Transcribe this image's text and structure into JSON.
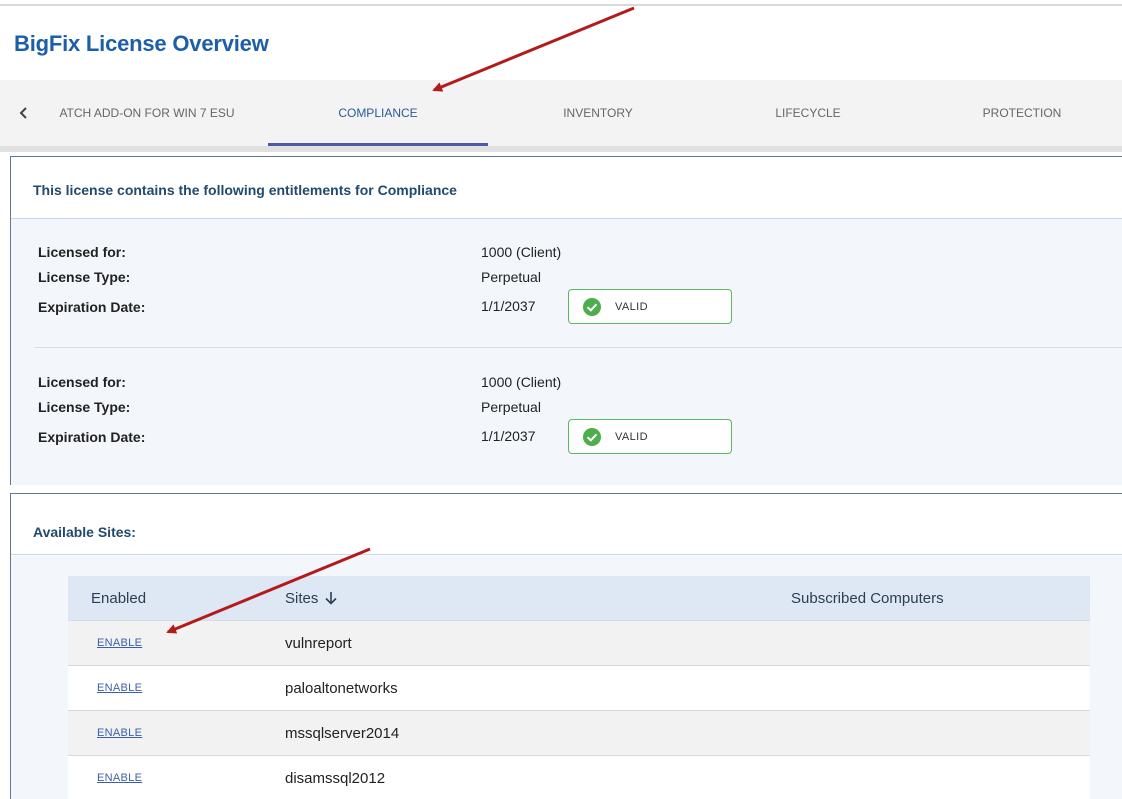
{
  "page": {
    "title": "BigFix License Overview"
  },
  "tabs": {
    "items": [
      {
        "label": "ATCH ADD-ON FOR WIN 7 ESU"
      },
      {
        "label": "COMPLIANCE",
        "active": true
      },
      {
        "label": "INVENTORY"
      },
      {
        "label": "LIFECYCLE"
      },
      {
        "label": "PROTECTION"
      }
    ]
  },
  "entitlements": {
    "heading": "This license contains the following entitlements for Compliance",
    "labels": {
      "licensed_for": "Licensed for:",
      "license_type": "License Type:",
      "expiration": "Expiration Date:"
    },
    "items": [
      {
        "licensed_for": "1000 (Client)",
        "license_type": "Perpetual",
        "expiration": "1/1/2037",
        "status": "VALID"
      },
      {
        "licensed_for": "1000 (Client)",
        "license_type": "Perpetual",
        "expiration": "1/1/2037",
        "status": "VALID"
      }
    ]
  },
  "sites": {
    "heading": "Available Sites:",
    "columns": {
      "enabled": "Enabled",
      "sites": "Sites",
      "subscribed": "Subscribed Computers"
    },
    "rows": [
      {
        "action": "ENABLE",
        "site": "vulnreport"
      },
      {
        "action": "ENABLE",
        "site": "paloaltonetworks"
      },
      {
        "action": "ENABLE",
        "site": "mssqlserver2014"
      },
      {
        "action": "ENABLE",
        "site": "disamssql2012"
      }
    ]
  },
  "colors": {
    "title": "#1c5fa8",
    "valid": "#5cb85c",
    "annotation_arrow": "#b31b1b",
    "link": "#3b5fab"
  },
  "icons": {
    "tab_scroll": "chevron-left-icon",
    "valid": "check-circle-icon",
    "sort": "arrow-down-icon"
  }
}
